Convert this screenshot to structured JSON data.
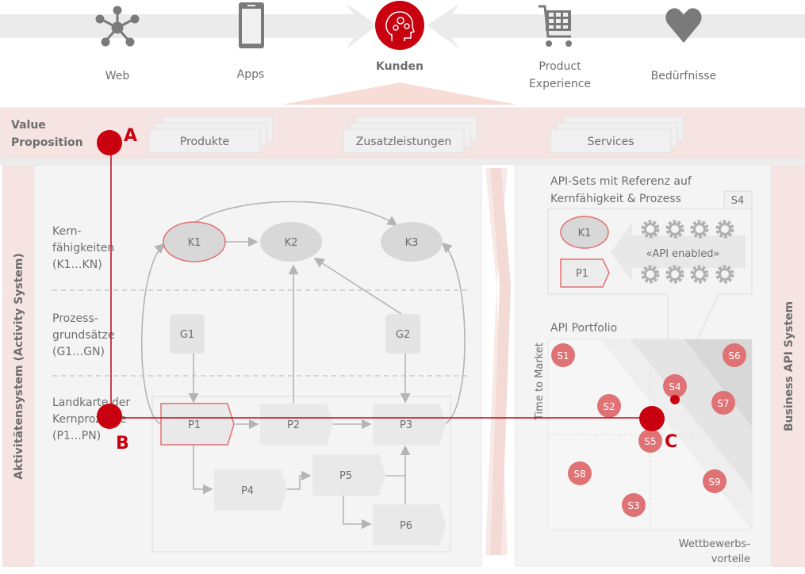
{
  "top": {
    "items": [
      {
        "label": "Web",
        "icon": "network-icon"
      },
      {
        "label": "Apps",
        "icon": "smartphone-icon"
      },
      {
        "label": "Kunden",
        "icon": "head-gears-icon"
      },
      {
        "label_lines": [
          "Product",
          "Experience"
        ],
        "icon": "shopping-cart-icon"
      },
      {
        "label": "Bedürfnisse",
        "icon": "heart-icon"
      }
    ]
  },
  "value_proposition": {
    "title_lines": [
      "Value",
      "Proposition"
    ],
    "boxes": [
      "Produkte",
      "Zusatzleistungen",
      "Services"
    ]
  },
  "activity_system": {
    "title": "Aktivitätensystem (Activity System)",
    "rows": [
      {
        "lines": [
          "Kern-",
          "fähigkeiten",
          "(K1…KN)"
        ]
      },
      {
        "lines": [
          "Prozess-",
          "grundsätze",
          "(G1…GN)"
        ]
      },
      {
        "lines": [
          "Landkarte der",
          "Kernprozesse",
          "(P1…PN)"
        ]
      }
    ],
    "capabilities": [
      "K1",
      "K2",
      "K3"
    ],
    "principles": [
      "G1",
      "G2"
    ],
    "processes": [
      "P1",
      "P2",
      "P3",
      "P4",
      "P5",
      "P6"
    ]
  },
  "markers": {
    "a": "A",
    "b": "B",
    "c": "C"
  },
  "api": {
    "system_title": "Business API System",
    "sets_title_lines": [
      "API-Sets mit Referenz auf",
      "Kernfähigkeit & Prozess"
    ],
    "set_tab": "S4",
    "set_k": "K1",
    "set_p": "P1",
    "enabled_label": "«API enabled»",
    "portfolio_title": "API Portfolio",
    "y_label": "Time to Market",
    "x_label_lines": [
      "Wettbewerbs-",
      "vorteile"
    ],
    "points": [
      "S1",
      "S2",
      "S3",
      "S4",
      "S5",
      "S6",
      "S7",
      "S8",
      "S9"
    ]
  },
  "colors": {
    "accent": "#c8000f",
    "point": "#df7275",
    "pink": "#f5e4e1",
    "gray": "#6e6e6e"
  }
}
